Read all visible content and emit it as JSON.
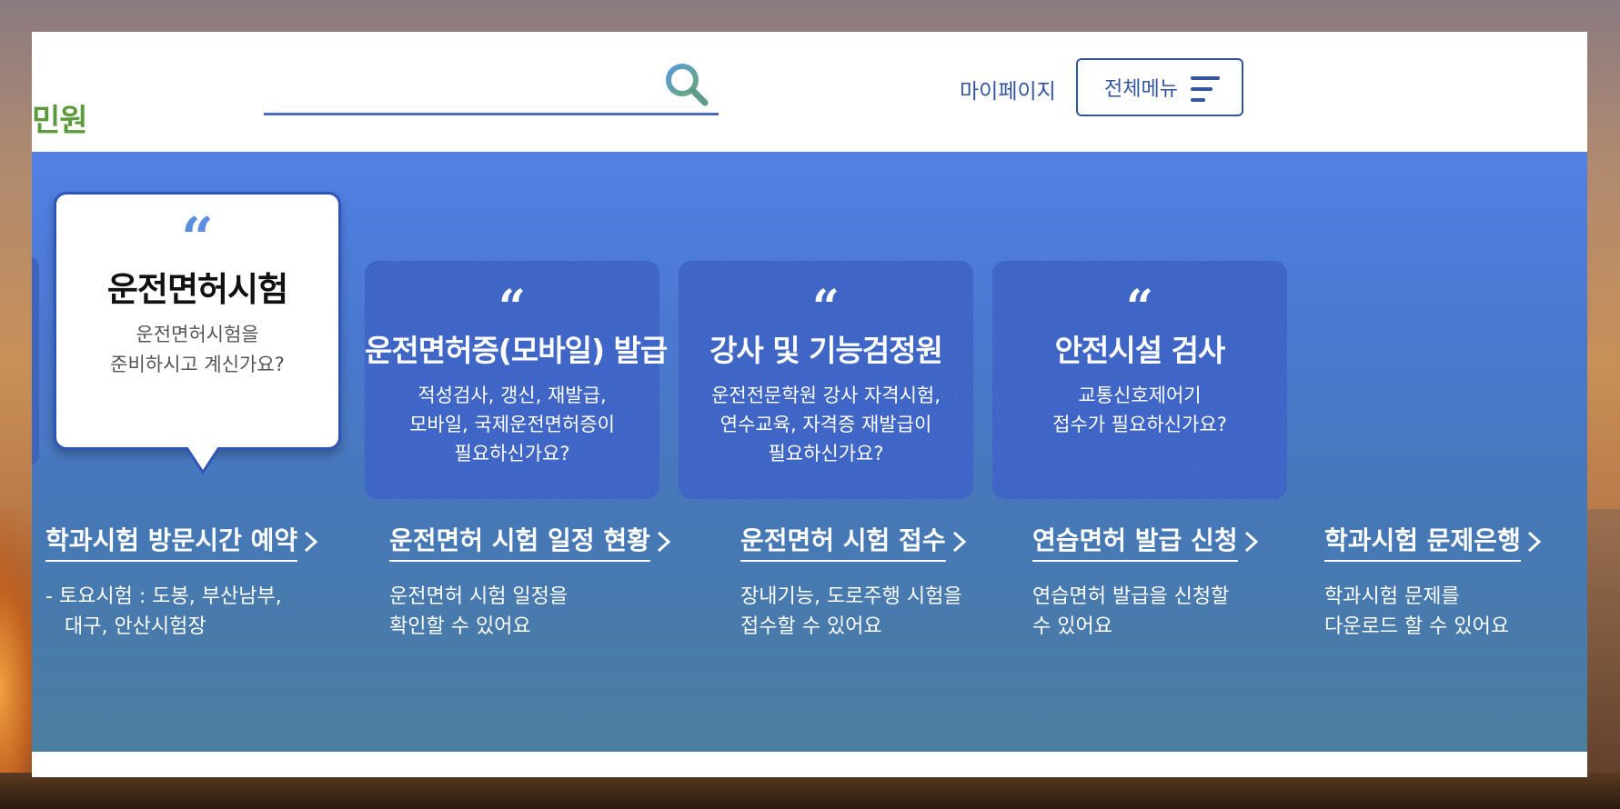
{
  "header": {
    "logo_fragment": "민원",
    "search": {
      "value": "",
      "placeholder": ""
    },
    "mypage_label": "마이페이지",
    "menu_label": "전체메뉴"
  },
  "colors": {
    "accent": "#3355a0",
    "panel_blue": "#5280e4",
    "card_blue": "#3f66c6",
    "logo_green": "#5a9a3a",
    "quote_blue": "#5a8fe0"
  },
  "icons": {
    "search": "search-icon",
    "menu": "hamburger-menu-icon",
    "quote": "quote-icon",
    "chevron": "chevron-right-icon"
  },
  "cards": [
    {
      "quote": "“",
      "title": "운전면허시험",
      "desc": [
        "운전면허시험을",
        "준비하시고 계신가요?"
      ]
    },
    {
      "quote": "“",
      "title": "운전면허증(모바일) 발급",
      "desc": [
        "적성검사, 갱신, 재발급,",
        "모바일, 국제운전면허증이",
        "필요하신가요?"
      ]
    },
    {
      "quote": "“",
      "title": "강사 및 기능검정원",
      "desc": [
        "운전전문학원 강사 자격시험,",
        "연수교육, 자격증 재발급이",
        "필요하신가요?"
      ]
    },
    {
      "quote": "“",
      "title": "안전시설 검사",
      "desc": [
        "교통신호제어기",
        "접수가 필요하신가요?"
      ]
    }
  ],
  "links": [
    {
      "title": "학과시험 방문시간 예약",
      "desc": [
        "- 토요시험 : 도봉, 부산남부,",
        "   대구, 안산시험장"
      ]
    },
    {
      "title": "운전면허 시험 일정 현황",
      "desc": [
        "운전면허 시험 일정을",
        "확인할 수 있어요"
      ]
    },
    {
      "title": "운전면허 시험 접수",
      "desc": [
        "장내기능, 도로주행 시험을",
        "접수할 수 있어요"
      ]
    },
    {
      "title": "연습면허 발급 신청",
      "desc": [
        "연습면허 발급을 신청할",
        "수 있어요"
      ]
    },
    {
      "title": "학과시험 문제은행",
      "desc": [
        "학과시험 문제를",
        "다운로드 할 수 있어요"
      ]
    }
  ]
}
